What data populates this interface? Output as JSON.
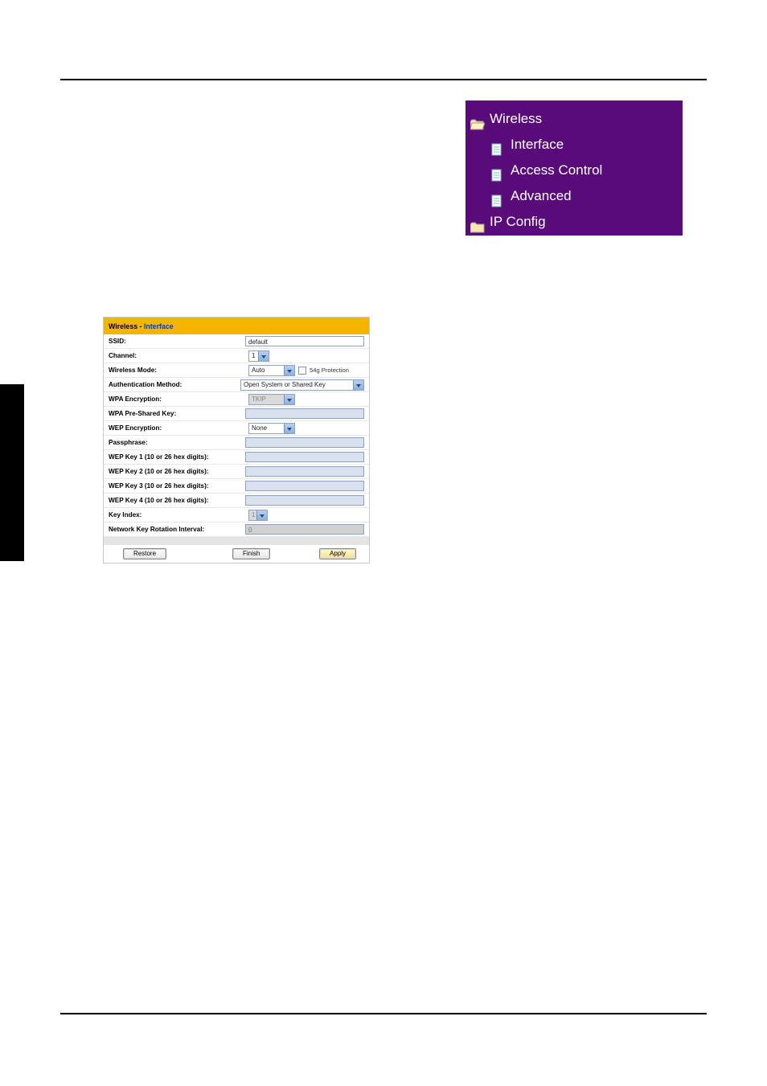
{
  "nav_tree": {
    "wireless": "Wireless",
    "interface": "Interface",
    "access_control": "Access Control",
    "advanced": "Advanced",
    "ip_config": "IP Config"
  },
  "panel": {
    "title_prefix": "Wireless - ",
    "title_accent": "Interface",
    "rows": {
      "ssid_label": "SSID:",
      "ssid_value": "default",
      "channel_label": "Channel:",
      "channel_value": "1",
      "mode_label": "Wireless Mode:",
      "mode_value": "Auto",
      "protection_label": "54g Protection",
      "auth_label": "Authentication Method:",
      "auth_value": "Open System or Shared Key",
      "wpa_enc_label": "WPA Encryption:",
      "wpa_enc_value": "TKIP",
      "wpa_psk_label": "WPA Pre-Shared Key:",
      "wep_enc_label": "WEP Encryption:",
      "wep_enc_value": "None",
      "passphrase_label": "Passphrase:",
      "wep1_label": "WEP Key 1 (10 or 26 hex digits):",
      "wep2_label": "WEP Key 2 (10 or 26 hex digits):",
      "wep3_label": "WEP Key 3 (10 or 26 hex digits):",
      "wep4_label": "WEP Key 4 (10 or 26 hex digits):",
      "keyidx_label": "Key Index:",
      "keyidx_value": "1",
      "rotation_label": "Network Key Rotation Interval:",
      "rotation_value": "0"
    },
    "buttons": {
      "restore": "Restore",
      "finish": "Finish",
      "apply": "Apply"
    }
  }
}
